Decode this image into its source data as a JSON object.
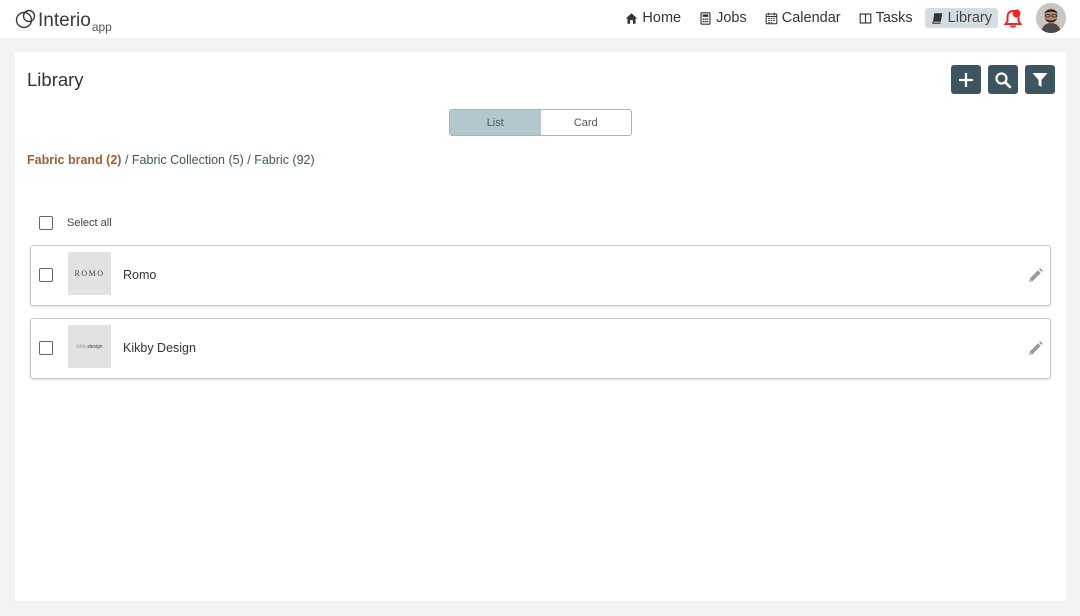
{
  "app": {
    "brand": "Interio",
    "suffix": "app"
  },
  "nav": {
    "items": [
      {
        "label": "Home",
        "icon": "home-icon"
      },
      {
        "label": "Jobs",
        "icon": "calculator-icon"
      },
      {
        "label": "Calendar",
        "icon": "calendar-icon"
      },
      {
        "label": "Tasks",
        "icon": "columns-icon"
      },
      {
        "label": "Library",
        "icon": "book-icon",
        "active": true
      }
    ],
    "notification_icon": "bell-icon"
  },
  "page": {
    "title": "Library"
  },
  "view_toggle": {
    "options": [
      "List",
      "Card"
    ],
    "selected": "List"
  },
  "breadcrumb": {
    "current": "Fabric brand (2)",
    "links": [
      "Fabric Collection (5)",
      "Fabric (92)"
    ],
    "separator": "/"
  },
  "select_all": {
    "label": "Select all"
  },
  "items": [
    {
      "name": "Romo",
      "logo_text": "ROMO"
    },
    {
      "name": "Kikby Design",
      "logo_text_light": "kikby",
      "logo_text_dark": "design"
    }
  ],
  "colors": {
    "accent": "#3d5560",
    "breadcrumb_current": "#a65d2e",
    "notification": "#e8272a",
    "active_nav": "#d4dde2"
  }
}
